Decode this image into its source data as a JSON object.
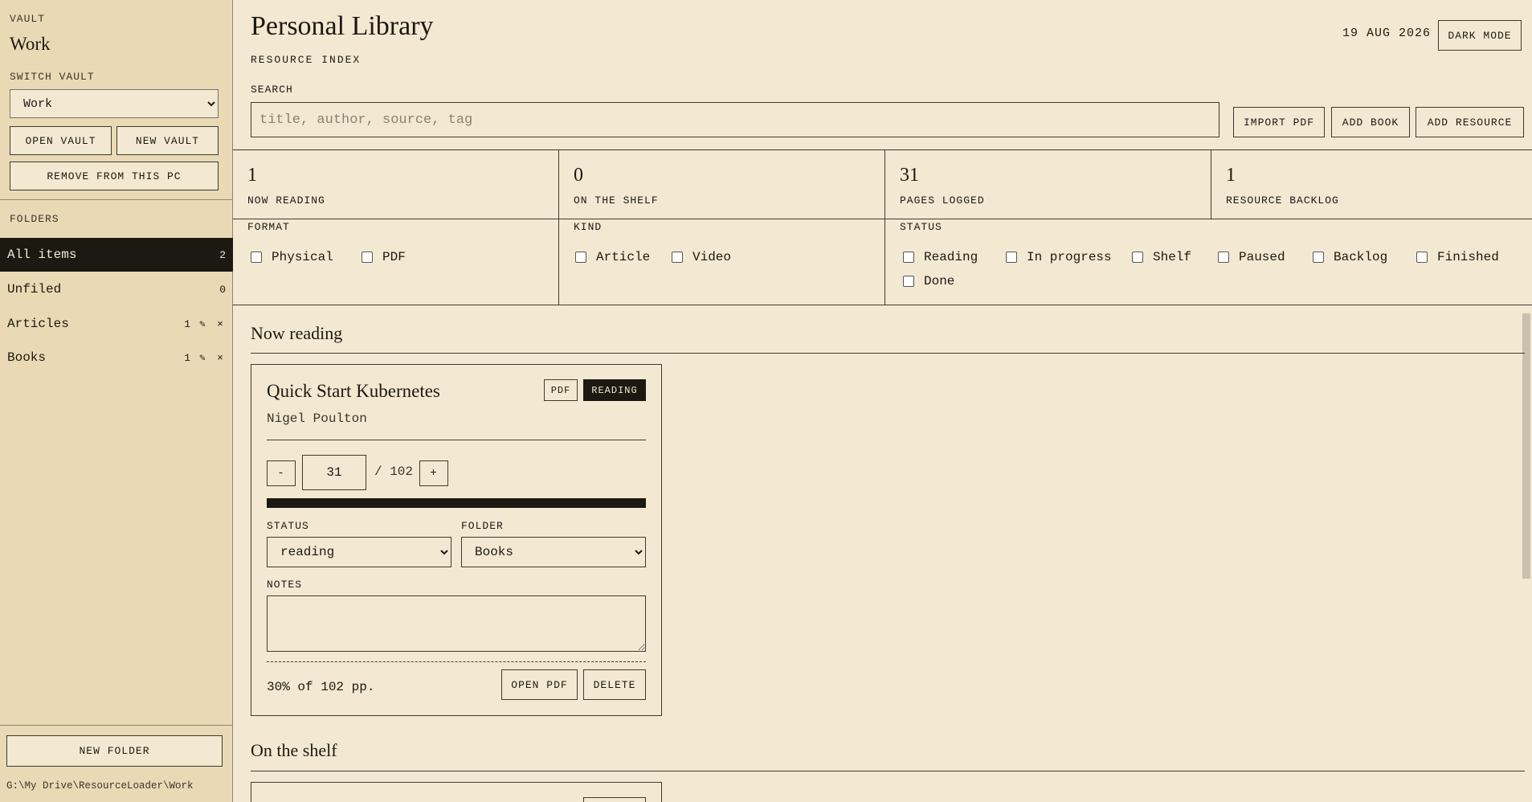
{
  "sidebar": {
    "vault_label": "Vault",
    "vault_name": "Work",
    "switch_label": "Switch vault",
    "vault_select_value": "Work",
    "open_vault": "Open vault",
    "new_vault": "New vault",
    "remove_pc": "Remove from this PC",
    "folders_label": "Folders",
    "folders": [
      {
        "name": "All items",
        "count": "2",
        "active": true,
        "editable": false
      },
      {
        "name": "Unfiled",
        "count": "0",
        "active": false,
        "editable": false
      },
      {
        "name": "Articles",
        "count": "1",
        "active": false,
        "editable": true
      },
      {
        "name": "Books",
        "count": "1",
        "active": false,
        "editable": true
      }
    ],
    "edit_icon": "✎",
    "remove_icon": "×",
    "new_folder": "New folder",
    "vault_path": "G:\\My Drive\\ResourceLoader\\Work"
  },
  "header": {
    "title": "Personal Library",
    "subtitle": "Resource index",
    "date": "19 AUG 2026",
    "dark_mode": "Dark mode",
    "search_label": "Search",
    "search_placeholder": "title, author, source, tag",
    "import_pdf": "Import PDF",
    "add_book": "Add book",
    "add_resource": "Add resource"
  },
  "stats": [
    {
      "value": "1",
      "label": "Now reading"
    },
    {
      "value": "0",
      "label": "On the shelf"
    },
    {
      "value": "31",
      "label": "Pages logged"
    },
    {
      "value": "1",
      "label": "Resource backlog"
    }
  ],
  "filters": {
    "format": {
      "label": "Format",
      "options": [
        "Physical",
        "PDF"
      ]
    },
    "kind": {
      "label": "Kind",
      "options": [
        "Article",
        "Video"
      ]
    },
    "status": {
      "label": "Status",
      "options": [
        "Reading",
        "In progress",
        "Shelf",
        "Paused",
        "Backlog",
        "Finished",
        "Done"
      ]
    }
  },
  "sections": {
    "now_reading": "Now reading",
    "on_the_shelf": "On the shelf"
  },
  "card": {
    "title": "Quick Start Kubernetes",
    "author": "Nigel Poulton",
    "format_badge": "PDF",
    "status_badge": "Reading",
    "minus": "-",
    "plus": "+",
    "current_page": "31",
    "total_pages_text": "/ 102",
    "progress_fraction": 0.304,
    "status_label": "Status",
    "status_value": "reading",
    "folder_label": "Folder",
    "folder_value": "Books",
    "notes_label": "Notes",
    "progress_text": "30% of 102 pp.",
    "open_pdf": "Open PDF",
    "delete": "Delete"
  },
  "colors": {
    "background": "#f3e9d2",
    "sidebar": "#e9dab5",
    "ink": "#1c1812"
  }
}
